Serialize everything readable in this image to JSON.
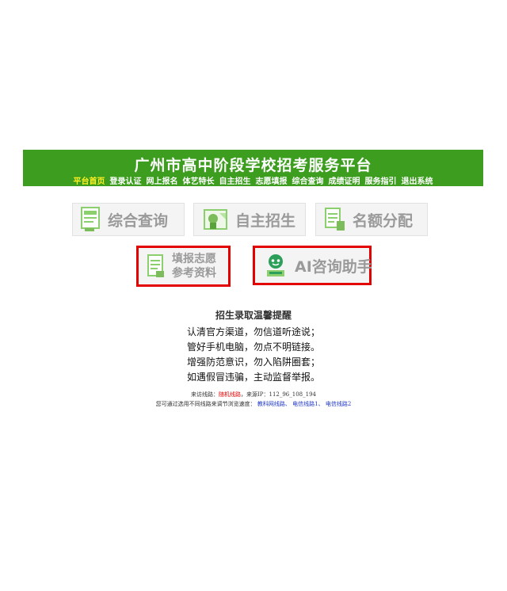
{
  "header": {
    "title": "广州市高中阶段学校招考服务平台",
    "nav": [
      "平台首页",
      "登录认证",
      "网上报名",
      "体艺特长",
      "自主招生",
      "志愿填报",
      "综合查询",
      "成绩证明",
      "服务指引",
      "退出系统"
    ]
  },
  "tiles": {
    "t1": "综合查询",
    "t2": "自主招生",
    "t3": "名额分配",
    "t4_line1": "填报志愿",
    "t4_line2": "参考资料",
    "t5": "AI咨询助手"
  },
  "notice": {
    "title": "招生录取温馨提醒",
    "lines": [
      "认清官方渠道，勿信道听途说；",
      "管好手机电脑，勿点不明链接。",
      "增强防范意识，勿入陷阱圈套；",
      "如遇假冒违骗，主动监督举报。"
    ]
  },
  "meta": {
    "line_label": "来访线路：",
    "line_value": "随机线路",
    "ip_label": "，来源IP：",
    "ip_value": "112_96_108_194",
    "hint": "您可通过选用不同线路来调节浏览速度：",
    "links": [
      "教科网线路、",
      "电信线路1、",
      "电信线路2"
    ]
  },
  "colors": {
    "banner": "#3c9d1e",
    "active_nav": "#ffee22",
    "highlight_border": "#e30000",
    "link": "#1e35c8"
  }
}
